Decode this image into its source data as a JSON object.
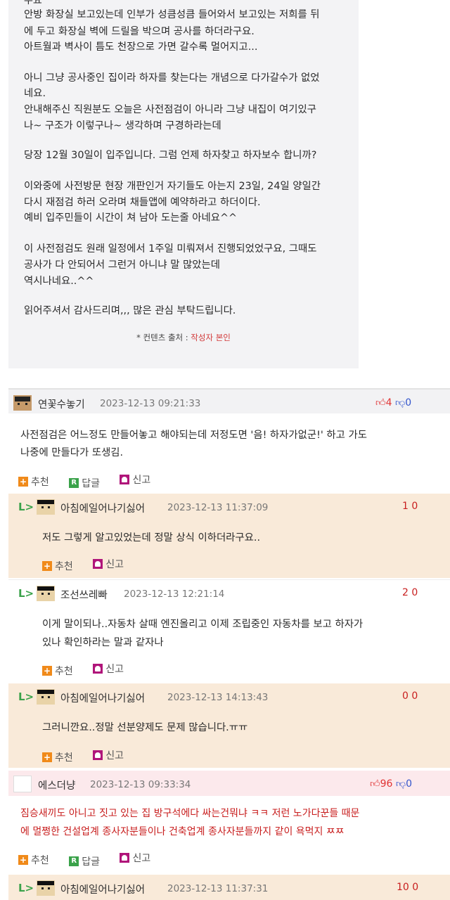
{
  "article": {
    "cut_top": "우요",
    "lines": [
      "안방 화장실 보고있는데 인부가 성큼성큼 들어와서 보고있는 저희를 뒤",
      "에 두고 화장실 벽에 드릴을 박으며 공사를 하더라구요.",
      "아트월과 벽사이 틈도 천장으로 가면 갈수록 멀어지고...",
      "",
      "아니 그냥 공사중인 집이라 하자를 찾는다는 개념으로 다가갈수가 없었",
      "네요.",
      "안내해주신 직원분도 오늘은 사전점검이 아니라 그냥 내집이 여기있구",
      "나~ 구조가 이렇구나~ 생각하며 구경하라는데",
      "",
      "당장 12월 30일이 입주입니다. 그럼 언제 하자찾고 하자보수 합니까?",
      "",
      "이와중에 사전방문 현장 개판인거 자기들도 아는지 23일, 24일 양일간",
      "다시 재점검 하러 오라며 채들앱에 예약하라고 하더이다.",
      "예비 입주민들이 시간이 쳐 남아 도는줄 아네요^^",
      "",
      "이 사전점검도 원래 일정에서 1주일 미뤄져서 진행되었었구요, 그때도",
      "공사가 다 안되어서 그런거 아니냐 말 많았는데",
      "역시나네요..^^",
      "",
      "읽어주셔서 감사드리며,,, 많은 관심 부탁드립니다."
    ],
    "source_prefix": "* 컨텐츠 출처 : ",
    "source_value": "작성자 본인"
  },
  "labels": {
    "recommend": "추천",
    "reply": "답글",
    "report": "신고",
    "reply_arrow": "L>"
  },
  "comments": [
    {
      "nick": "연꽃수놓기",
      "date": "2023-12-13 09:21:33",
      "up": "4",
      "down": "0",
      "lines": [
        "사전점검은 어느정도 만들어놓고 해야되는데 저정도면 '음! 하자가없군!' 하고 가도",
        "나중에 만들다가 또생김."
      ]
    },
    {
      "nick": "아침에일어나기싫어",
      "date": "2023-12-13 11:37:09",
      "score": "1 0",
      "lines": [
        "저도 그렇게 알고있었는데 정말 상식 이하더라구요.."
      ]
    },
    {
      "nick": "조선쓰레빠",
      "date": "2023-12-13 12:21:14",
      "score": "2 0",
      "lines": [
        "이게 말이되나..자동차 살때 엔진올리고 이제 조립중인 자동차를 보고 하자가",
        "있나 확인하라는 말과 같자나"
      ]
    },
    {
      "nick": "아침에일어나기싫어",
      "date": "2023-12-13 14:13:43",
      "score": "0 0",
      "lines": [
        "그러니깐요..정말 선분양제도 문제 많습니다.ㅠㅠ"
      ]
    },
    {
      "nick": "에스더냥",
      "date": "2023-12-13 09:33:34",
      "up": "96",
      "down": "0",
      "lines": [
        "짐승새끼도 아니고 짓고 있는 집 방구석에다 싸는건뭐냐 ㅋㅋ 저런 노가다꾼들 때문",
        "에 멀쩡한 건설업계 종사자분들이나 건축업계 종사자분들까지 같이 욕먹지 ㅉㅉ"
      ]
    },
    {
      "nick": "아침에일어나기싫어",
      "date": "2023-12-13 11:37:31",
      "score": "10 0"
    }
  ],
  "colors": {
    "reply_bg": "#f9ead9",
    "best_bg": "#fce9ec",
    "accent_red": "#c81e1e",
    "green": "#3aa24a"
  }
}
